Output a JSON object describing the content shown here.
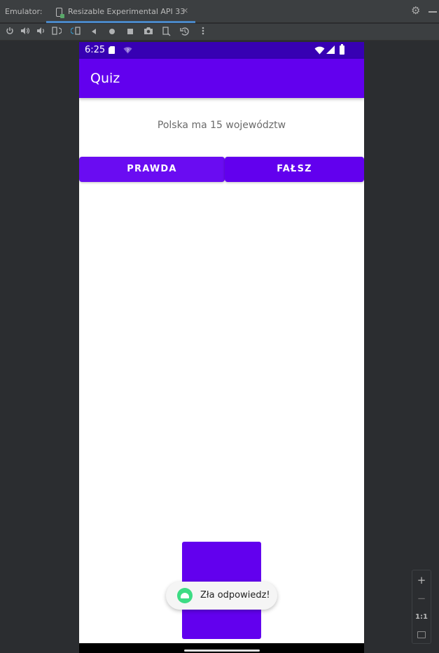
{
  "emulator": {
    "label": "Emulator:",
    "tab_title": "Resizable Experimental API 33",
    "tab_close": "✕",
    "settings_icon": "gear-icon",
    "toolbar_icons": [
      "power-icon",
      "volume-up-icon",
      "volume-down-icon",
      "rotate-left-icon",
      "rotate-right-icon",
      "back-icon",
      "home-icon",
      "overview-icon",
      "screenshot-icon",
      "fold-icon",
      "snapshot-icon",
      "more-icon"
    ],
    "zoom": {
      "zoom_in": "+",
      "zoom_out": "−",
      "actual_size": "1:1"
    }
  },
  "device": {
    "status_bar": {
      "time": "6:25",
      "color": "#3700b3"
    },
    "app_bar": {
      "title": "Quiz",
      "color": "#6200ee"
    },
    "question": "Polska ma 15 województw",
    "buttons": {
      "true_label": "PRAWDA",
      "false_label": "FAŁSZ"
    },
    "toast": {
      "text": "Zła odpowiedz!"
    }
  }
}
